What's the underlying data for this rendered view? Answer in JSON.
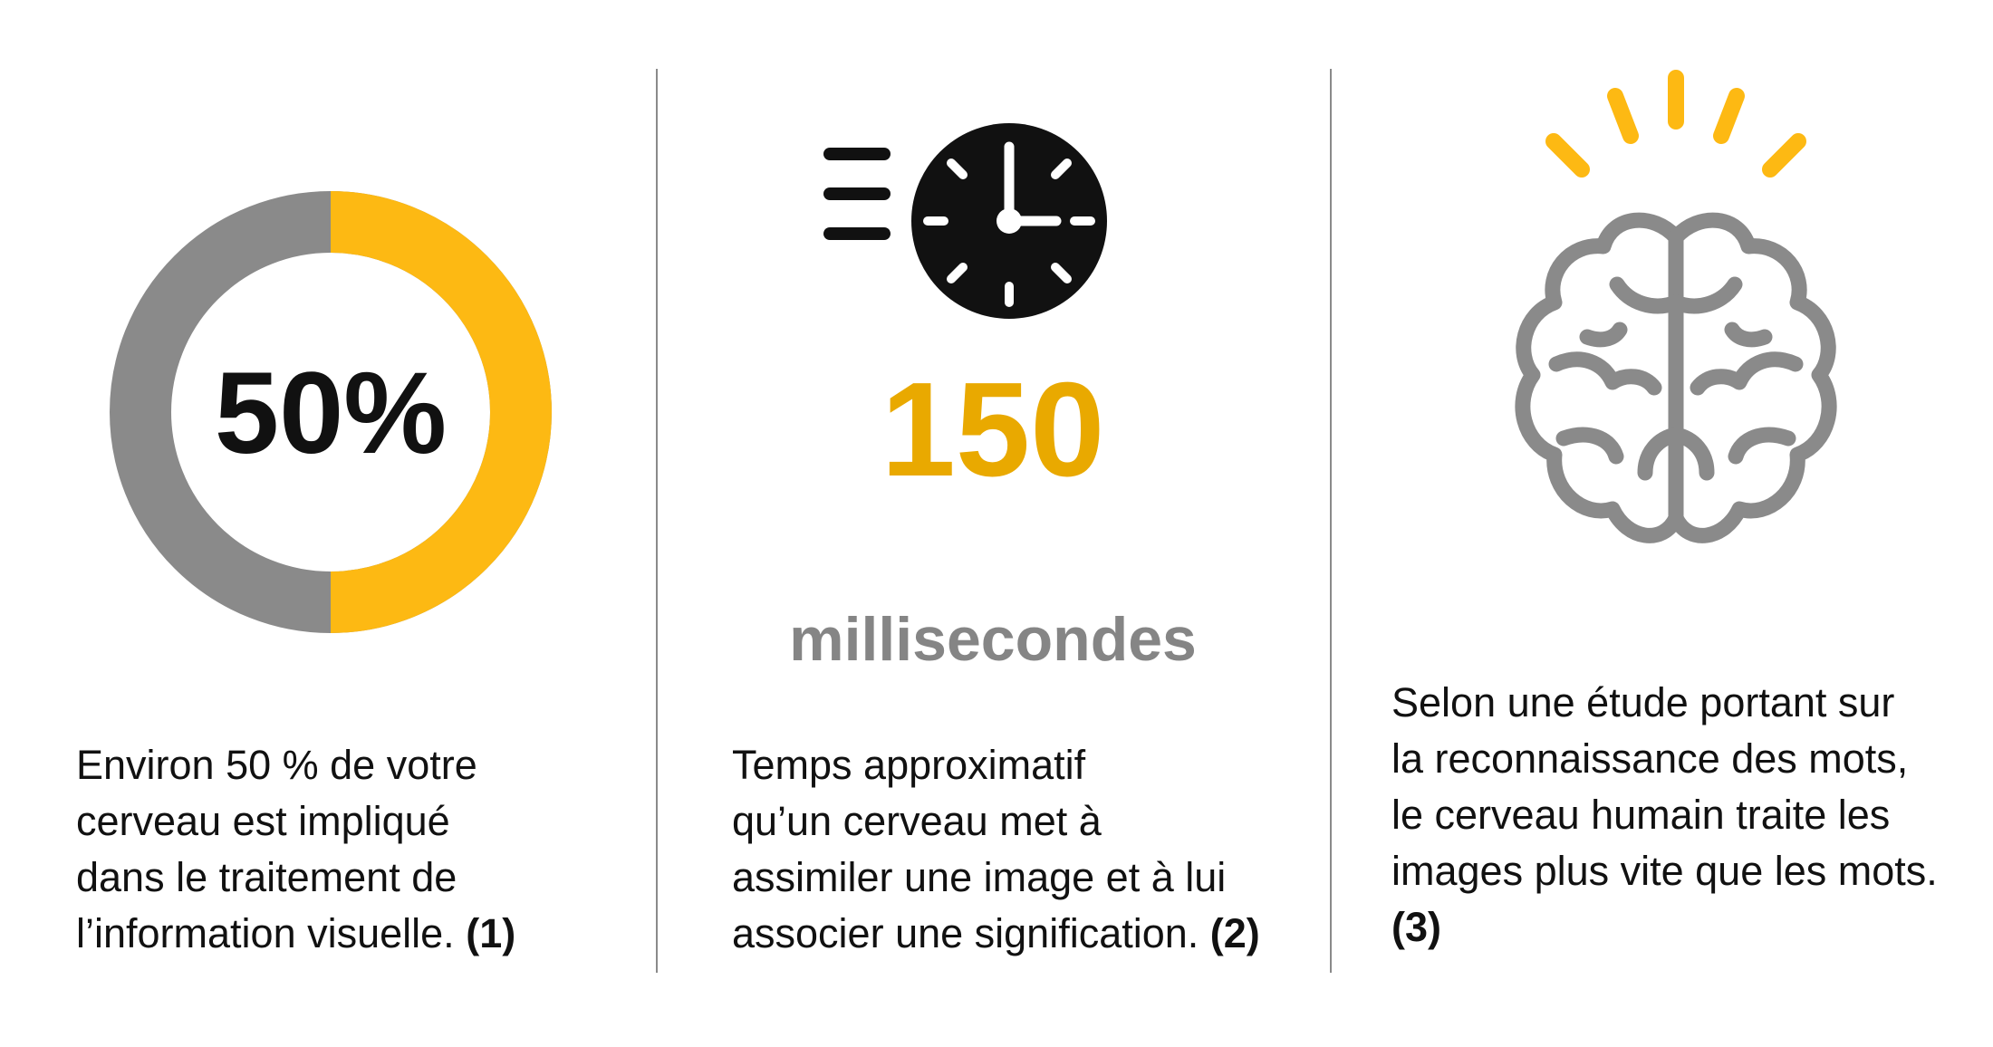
{
  "colors": {
    "accent_yellow": "#FDB913",
    "gray": "#8A8A8A",
    "black": "#111111"
  },
  "panels": [
    {
      "icon": "donut-chart-icon",
      "donut_value": "50%",
      "donut_fraction": 0.5,
      "desc_lines": [
        "Environ 50 % de votre",
        "cerveau est impliqué",
        "dans le traitement de",
        "l’information visuelle."
      ],
      "ref": "(1)"
    },
    {
      "icon": "fast-clock-icon",
      "big_number": "150",
      "unit": "millisecondes",
      "desc_lines": [
        "Temps approximatif",
        "qu’un cerveau met à",
        "assimiler une image et à lui",
        "associer une signification."
      ],
      "ref": "(2)"
    },
    {
      "icon": "brain-icon",
      "desc_lines": [
        "Selon une étude portant sur",
        "la reconnaissance des mots,",
        "le cerveau humain traite les",
        "images plus vite que les mots."
      ],
      "ref": "(3)"
    }
  ]
}
